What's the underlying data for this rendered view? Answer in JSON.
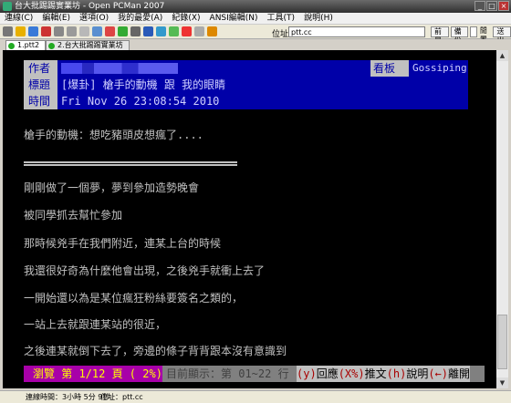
{
  "window": {
    "title": "台大批踢踢實業坊 - Open PCMan 2007"
  },
  "menu": [
    "連線(C)",
    "編輯(E)",
    "選項(O)",
    "我的最愛(A)",
    "紀錄(X)",
    "ANSI編輯(N)",
    "工具(T)",
    "說明(H)"
  ],
  "toolbar": {
    "address_label": "位址：",
    "address_value": "ptt.cc",
    "btn_front": "前景",
    "btn_backup": "備份",
    "label_idle": "閒置",
    "dropdown": "送出"
  },
  "tabs": [
    {
      "label": "1.ptt2"
    },
    {
      "label": "2.台大批踢踢實業坊"
    }
  ],
  "header": {
    "author_label": "作者",
    "author_value": "",
    "board_label": "看板",
    "board_value": "Gossiping",
    "title_label": "標題",
    "title_value": "[爆卦] 槍手的動機 跟 我的眼睛",
    "time_label": "時間",
    "time_value": "Fri Nov 26 23:08:54 2010"
  },
  "body": {
    "line1": "槍手的動機：想吃豬頭皮想瘋了....",
    "lines": [
      "剛剛做了一個夢，夢到參加造勢晚會",
      "被同學抓去幫忙參加",
      "那時候兇手在我們附近，連某上台的時候",
      "我還很好奇為什麼他會出現，之後兇手就衝上去了",
      "一開始還以為是某位瘋狂粉絲要簽名之類的，",
      "一站上去就跟連某站的很近，",
      "之後連某就倒下去了，旁邊的條子背背跟本沒有意識到"
    ]
  },
  "status": {
    "browse": "瀏覽 第 1/12 頁 ( 2%)",
    "range": "目前顯示：第 01~22 行",
    "k1": "(y)",
    "t1": "回應",
    "k2": "(X%)",
    "t2": "推文",
    "k3": "(h)",
    "t3": "說明",
    "k4": "(←)",
    "t4": "離開"
  },
  "statusbar": {
    "time": "連線時間：3小時 5分 9秒",
    "addr": "位址：ptt.cc"
  },
  "colors": {
    "header_bg": "#0000a8",
    "terminal_bg": "#000000",
    "status_magenta": "#a800a8"
  }
}
